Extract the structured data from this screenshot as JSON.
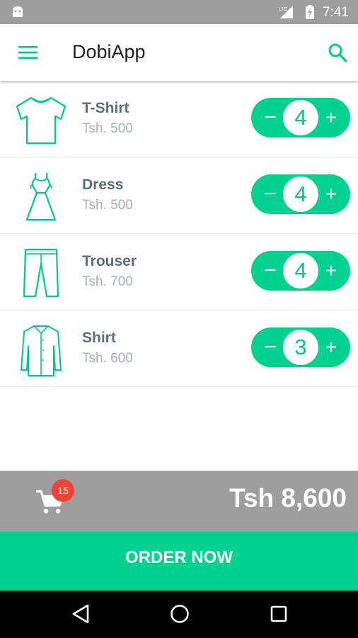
{
  "status_bar": {
    "network_label": "LTE",
    "time": "7:41",
    "icons": [
      "android-icon",
      "lte-signal-icon",
      "battery-charging-icon"
    ]
  },
  "app_bar": {
    "title": "DobiApp",
    "icons": [
      "menu-icon",
      "search-icon"
    ],
    "accent_color": "#00d28e"
  },
  "items": [
    {
      "name": "T-Shirt",
      "price": "Tsh. 500",
      "quantity": "4",
      "icon": "tshirt-icon",
      "minus": "−",
      "plus": "+"
    },
    {
      "name": "Dress",
      "price": "Tsh. 500",
      "quantity": "4",
      "icon": "dress-icon",
      "minus": "−",
      "plus": "+"
    },
    {
      "name": "Trouser",
      "price": "Tsh. 700",
      "quantity": "4",
      "icon": "trouser-icon",
      "minus": "−",
      "plus": "+"
    },
    {
      "name": "Shirt",
      "price": "Tsh. 600",
      "quantity": "3",
      "icon": "shirt-icon",
      "minus": "−",
      "plus": "+"
    }
  ],
  "cart": {
    "badge_count": "15",
    "total": "Tsh 8,600",
    "badge_color": "#f44336"
  },
  "order_button": {
    "label": "ORDER NOW"
  },
  "nav_bar": {
    "icons": [
      "back-icon",
      "home-icon",
      "recent-apps-icon"
    ]
  }
}
